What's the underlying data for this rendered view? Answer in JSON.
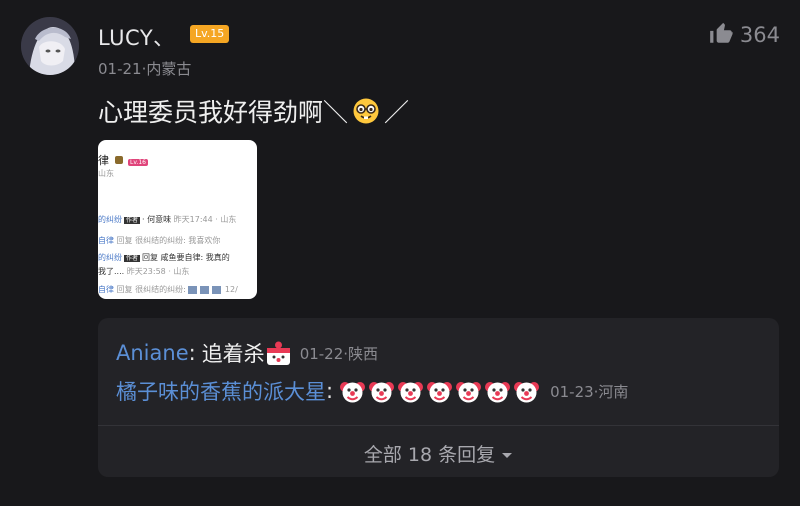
{
  "comment": {
    "username": "LUCY、",
    "level": "Lv.15",
    "meta": "01-21·内蒙古",
    "likes": "364",
    "text_before": "心理委员我好得劲啊＼",
    "emoji": "nerd-face",
    "text_after": "／"
  },
  "image_preview": {
    "line1": "律",
    "line1_badge": "Lv.16",
    "line2": "山东",
    "line3_name": "的纠纷",
    "line3_tag": "作者",
    "line3_text": "· 何意味",
    "line3_meta": "昨天17:44 · 山东",
    "line4_name": "自律",
    "line4_text": "回复 很纠结的纠纷: 我喜欢你",
    "line5_name": "的纠纷",
    "line5_tag": "作者",
    "line5_text": "回复 咸鱼要自律: 我真的",
    "line6_text": "我了....",
    "line6_meta": "昨天23:58 · 山东",
    "line7_name": "自律",
    "line7_text": "回复 很纠结的纠纷:",
    "line7_meta": "12/"
  },
  "replies": [
    {
      "name": "Aniane",
      "colon": ":",
      "text": "追着杀",
      "emoji": "clown-box",
      "meta": "01-22·陕西"
    },
    {
      "name": "橘子味的香蕉的派大星",
      "colon": ":",
      "emoji": "clown-face",
      "emoji_count": 7,
      "meta": "01-23·河南"
    }
  ],
  "more_replies": "全部 18 条回复",
  "colors": {
    "background": "#18181b",
    "reply_box": "#232327",
    "link_blue": "#5b8fd6",
    "level_orange": "#f5a623"
  }
}
